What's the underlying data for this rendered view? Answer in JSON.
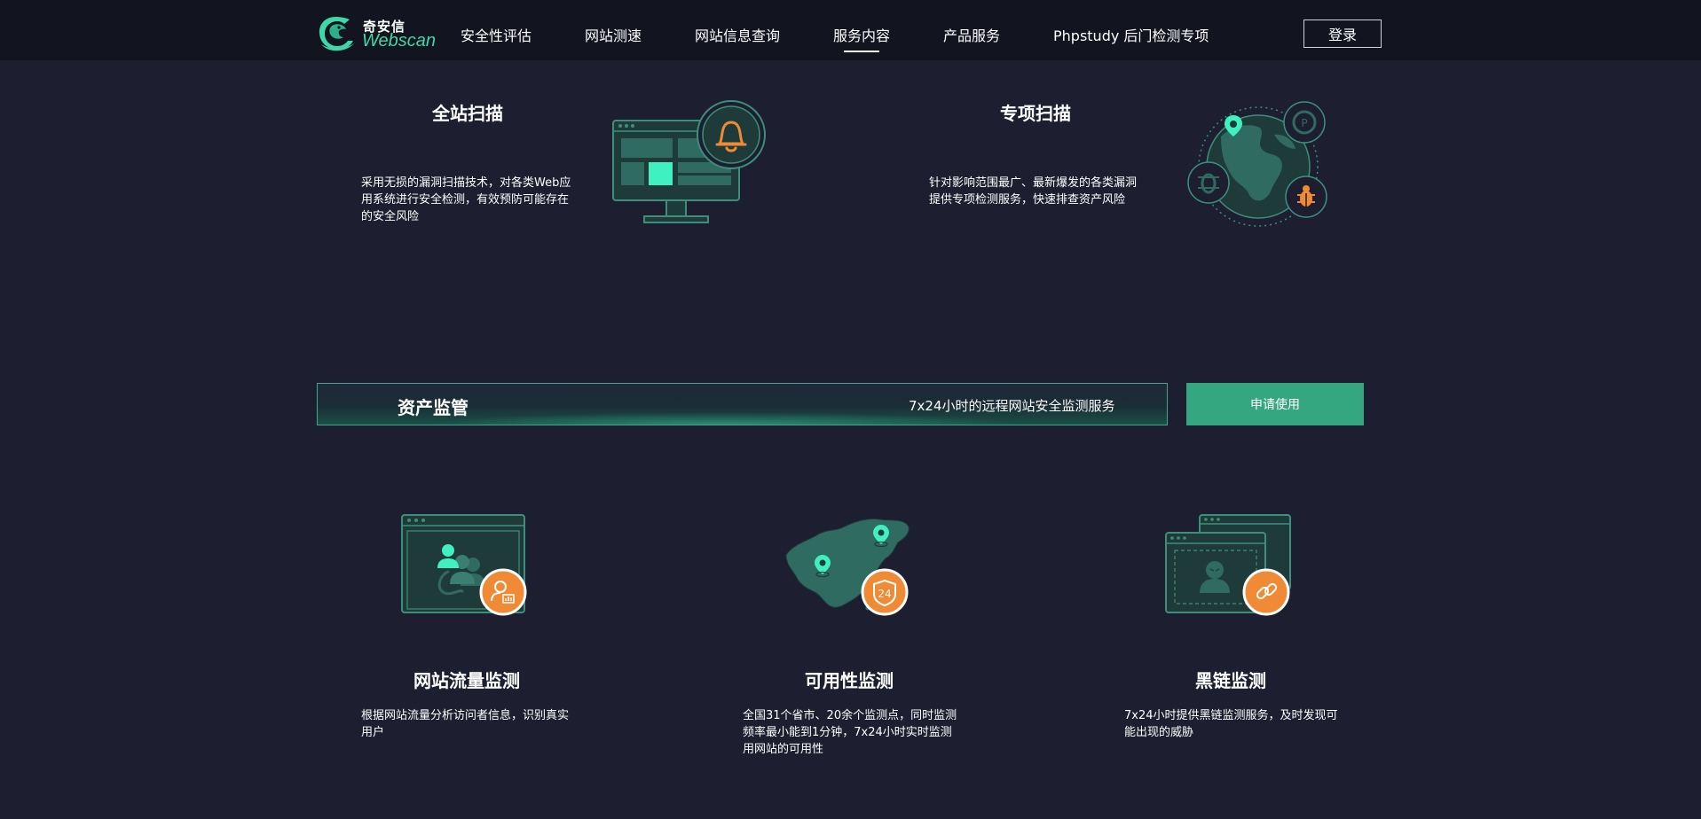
{
  "header": {
    "logo_cn": "奇安信",
    "logo_en": "Webscan",
    "nav": [
      {
        "label": "安全性评估"
      },
      {
        "label": "网站测速"
      },
      {
        "label": "网站信息查询"
      },
      {
        "label": "服务内容",
        "active": true
      },
      {
        "label": "产品服务"
      },
      {
        "label": "Phpstudy 后门检测专项"
      }
    ],
    "login_label": "登录"
  },
  "scan_cards": [
    {
      "title": "全站扫描",
      "desc": "采用无损的漏洞扫描技术，对各类Web应用系统进行安全检测，有效预防可能存在的安全风险",
      "icon": "monitor-bell-icon"
    },
    {
      "title": "专项扫描",
      "desc": "针对影响范围最广、最新爆发的各类漏洞提供专项检测服务，快速排查资产风险",
      "icon": "globe-bug-icon"
    }
  ],
  "asset": {
    "title": "资产监管",
    "subtitle": "7x24小时的远程网站安全监测服务",
    "apply_label": "申请使用"
  },
  "monitor_cards": [
    {
      "title": "网站流量监测",
      "desc": "根据网站流量分析访问者信息，识别真实用户",
      "icon": "traffic-users-icon"
    },
    {
      "title": "可用性监测",
      "desc": "全国31个省市、20余个监测点，同时监测频率最小能到1分钟，7x24小时实时监测用网站的可用性",
      "icon": "china-map-24-icon",
      "badge": "24"
    },
    {
      "title": "黑链监测",
      "desc": "7x24小时提供黑链监测服务，及时发现可能出现的威胁",
      "icon": "hacker-link-icon"
    }
  ],
  "colors": {
    "background": "#1d1f30",
    "header_bg": "#12141f",
    "accent_green": "#35a780",
    "icon_teal": "#1f4a45",
    "icon_line": "#3d8f7c",
    "highlight": "#3ff0c0",
    "orange": "#f08a35"
  }
}
